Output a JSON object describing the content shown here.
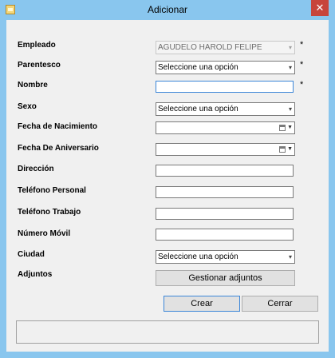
{
  "window": {
    "title": "Adicionar",
    "close_symbol": "✕",
    "app_icon": "form-window-icon"
  },
  "form": {
    "empleado_label": "Empleado",
    "empleado_value": "AGUDELO  HAROLD FELIPE",
    "parentesco_label": "Parentesco",
    "parentesco_value": "Seleccione una opción",
    "nombre_label": "Nombre",
    "nombre_value": "",
    "sexo_label": "Sexo",
    "sexo_value": "Seleccione una opción",
    "fecha_nacimiento_label": "Fecha de Nacimiento",
    "fecha_aniversario_label": "Fecha De Aniversario",
    "direccion_label": "Dirección",
    "direccion_value": "",
    "telefono_personal_label": "Teléfono Personal",
    "telefono_personal_value": "",
    "telefono_trabajo_label": "Teléfono Trabajo",
    "telefono_trabajo_value": "",
    "numero_movil_label": "Número Móvil",
    "numero_movil_value": "",
    "ciudad_label": "Ciudad",
    "ciudad_value": "Seleccione una opción",
    "adjuntos_label": "Adjuntos",
    "required_mark": "*"
  },
  "buttons": {
    "gestionar_adjuntos": "Gestionar adjuntos",
    "crear": "Crear",
    "cerrar": "Cerrar"
  },
  "status_bar": {
    "text": ""
  }
}
